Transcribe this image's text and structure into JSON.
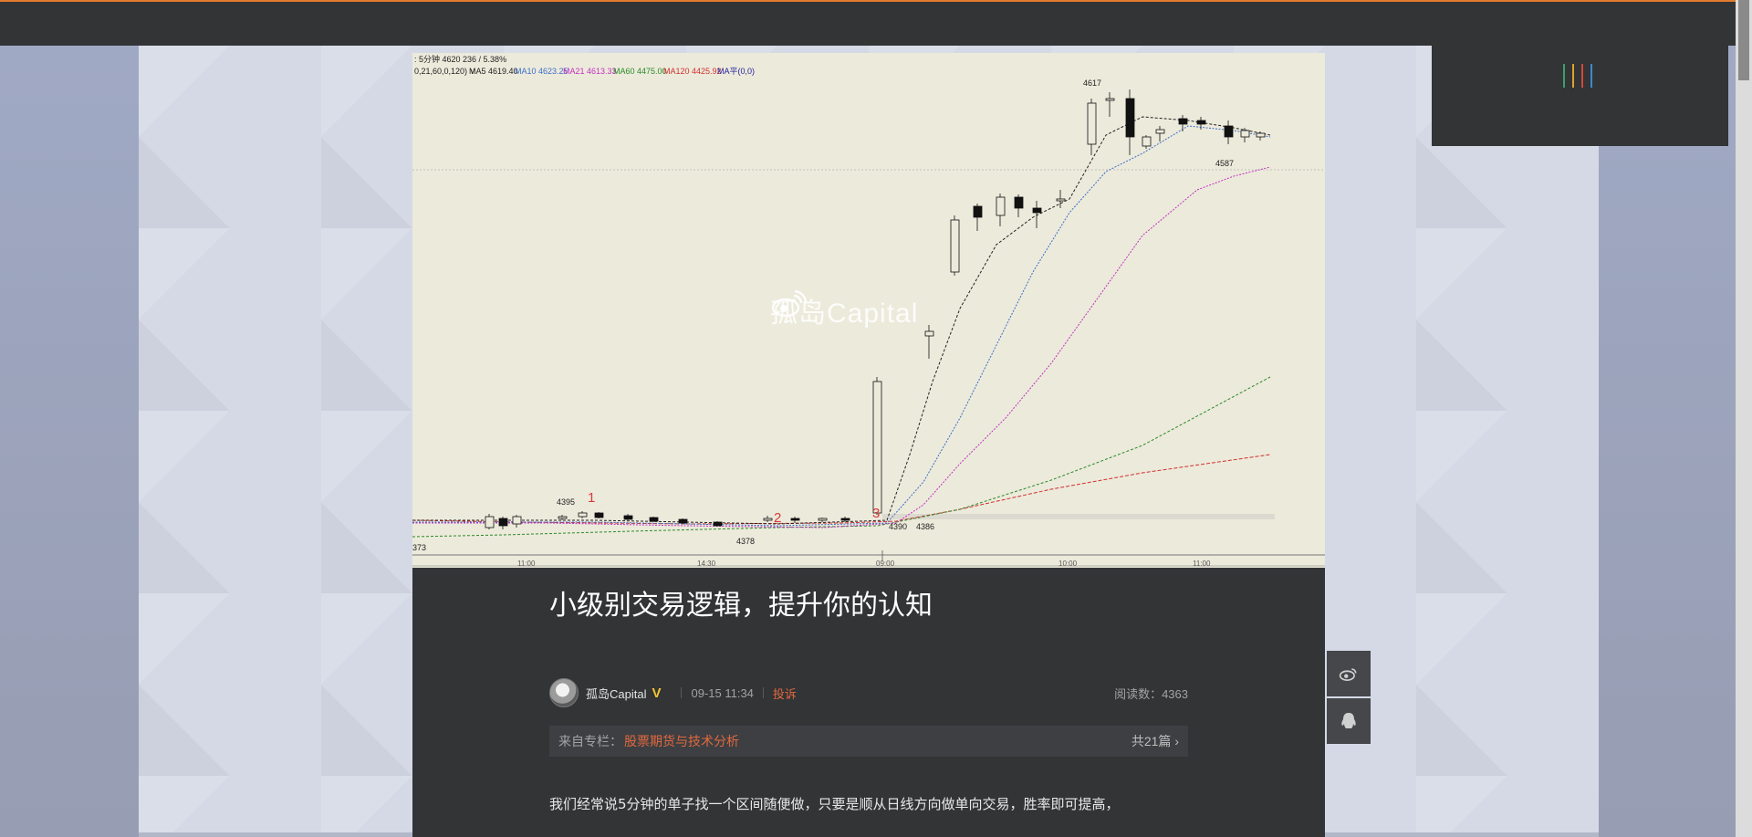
{
  "chart_image": {
    "header_line_1": [
      ": 5分钟 4620 236 / 5.38%"
    ],
    "ma_legend": [
      {
        "label": "0,21,60,0,120) ∨",
        "color": "#222222"
      },
      {
        "label": "MA5 4619.40",
        "color": "#222222"
      },
      {
        "label": "MA10 4623.25",
        "color": "#3d6ec9"
      },
      {
        "label": "MA21 4613.33",
        "color": "#c230c2"
      },
      {
        "label": "MA60 4475.00",
        "color": "#2a8a2a"
      },
      {
        "label": "MA120 4425.92",
        "color": "#d03030"
      },
      {
        "label": "MA平(0,0)",
        "color": "#222299"
      }
    ],
    "price_labels": [
      "4617",
      "4587",
      "4395",
      "4378",
      "4390",
      "4386",
      "373"
    ],
    "markers": [
      "1",
      "2",
      "3"
    ],
    "time_labels": [
      "11:00",
      "14:30",
      "09:00",
      "10:00",
      "11:00"
    ],
    "watermark": "孤岛Capital"
  },
  "article": {
    "title": "小级别交易逻辑，提升你的认知",
    "author": "孤岛Capital",
    "verified_badge": "V",
    "date": "09-15 11:34",
    "report_label": "投诉",
    "reads_label": "阅读数：4363",
    "column_prefix": "来自专栏：",
    "column_name": "股票期货与技术分析",
    "column_count": "共21篇",
    "body_first_line": "我们经常说5分钟的单子找一个区间随便做，只要是顺从日线方向做单向交易，胜率即可提高，"
  },
  "share_buttons": [
    {
      "icon": "weibo-icon"
    },
    {
      "icon": "qq-icon"
    }
  ],
  "colors": {
    "accent_orange": "#e27b2e",
    "dark_panel": "#323436",
    "link_red": "#e2683f",
    "badge_gold": "#f5c531"
  }
}
